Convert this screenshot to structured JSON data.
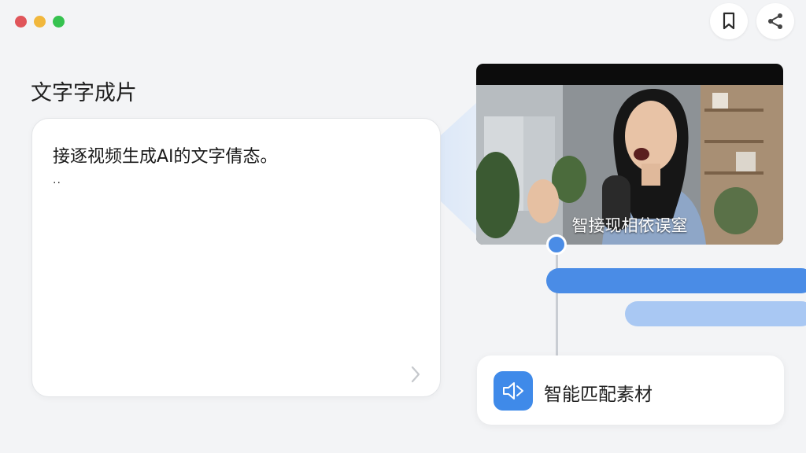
{
  "window": {
    "controls": [
      {
        "name": "close",
        "color": "#e0555a"
      },
      {
        "name": "minimize",
        "color": "#f1b73c"
      },
      {
        "name": "maximize",
        "color": "#36c24f"
      }
    ]
  },
  "toolbar": {
    "bookmark_icon": "bookmark-icon",
    "share_icon": "share-icon"
  },
  "section": {
    "title": "文字字成片"
  },
  "text_input": {
    "value": "接逐视频生成AI的文字倩态。",
    "cursor_text": ".."
  },
  "video_preview": {
    "subtitle": "智接现相依误窒"
  },
  "match_button": {
    "label": "智能匹配素材",
    "icon": "mute-speaker-icon"
  },
  "colors": {
    "accent": "#4a8ce6",
    "accent_light": "#a9c8f3",
    "background": "#f3f4f6"
  }
}
